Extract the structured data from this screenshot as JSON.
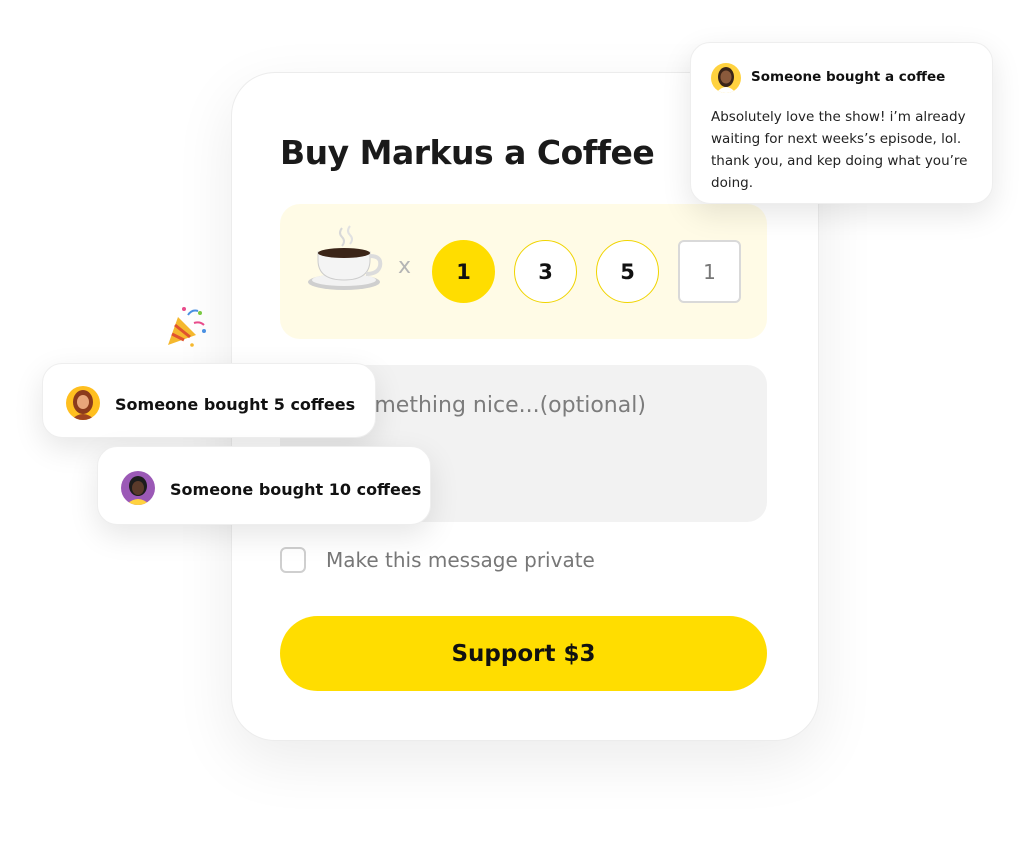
{
  "card": {
    "title": "Buy Markus a Coffee",
    "multiplier_symbol": "x",
    "quantity_options": [
      "1",
      "3",
      "5"
    ],
    "selected_quantity": "1",
    "custom_quantity_value": "1",
    "message_placeholder": "Say something nice...(optional)",
    "private_label": "Make this message private",
    "private_checked": false,
    "support_button_label": "Support $3"
  },
  "notifications": [
    {
      "title": "Someone bought a coffee",
      "body": "Absolutely love the show! i’m already waiting for next weeks’s episode, lol. thank you, and kep doing what you’re doing."
    },
    {
      "title": "Someone bought 5 coffees"
    },
    {
      "title": "Someone bought 10 coffees"
    }
  ],
  "icons": {
    "coffee": "coffee-cup-icon",
    "confetti": "party-popper-icon"
  },
  "colors": {
    "accent_yellow": "#FFDD00",
    "picker_background": "#FFFBE6",
    "message_background": "#F2F2F2",
    "muted_text": "#777777"
  }
}
